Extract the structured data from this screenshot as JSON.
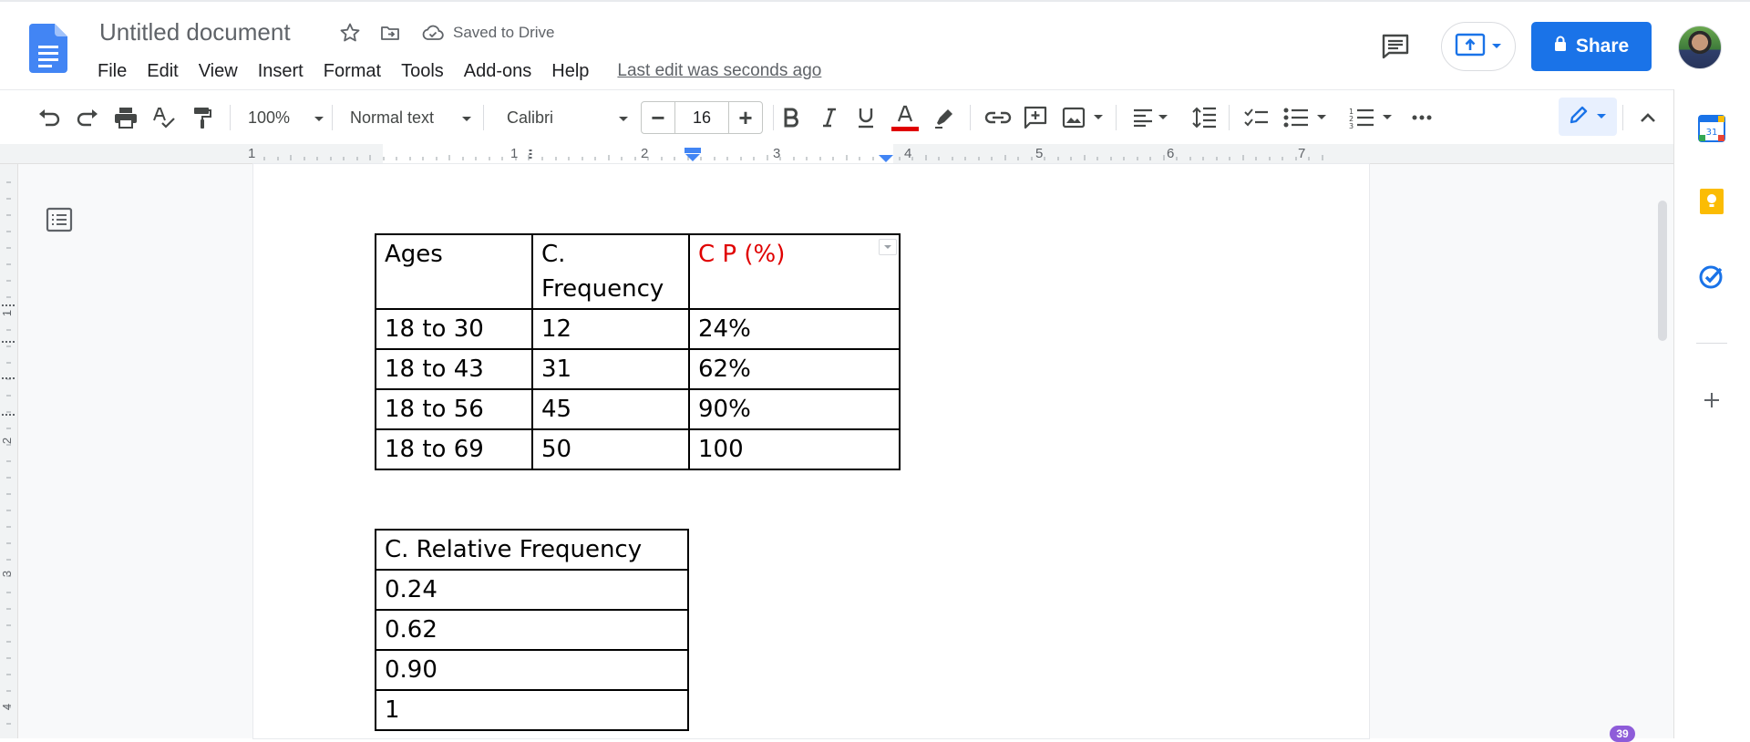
{
  "header": {
    "doc_title": "Untitled document",
    "saved_status": "Saved to Drive",
    "menu": [
      "File",
      "Edit",
      "View",
      "Insert",
      "Format",
      "Tools",
      "Add-ons",
      "Help"
    ],
    "last_edit": "Last edit was seconds ago",
    "share_label": "Share",
    "accent_color": "#1a73e8"
  },
  "toolbar": {
    "zoom": "100%",
    "style": "Normal text",
    "font": "Calibri",
    "font_size": "16",
    "minus": "−",
    "plus": "+",
    "icons": [
      "undo-icon",
      "redo-icon",
      "print-icon",
      "spellcheck-icon",
      "paint-format-icon",
      "bold-icon",
      "italic-icon",
      "underline-icon",
      "text-color-icon",
      "highlight-icon",
      "link-icon",
      "comment-add-icon",
      "image-icon",
      "align-icon",
      "line-spacing-icon",
      "checklist-icon",
      "bullet-list-icon",
      "numbered-list-icon",
      "more-icon",
      "edit-mode-icon",
      "collapse-icon"
    ]
  },
  "ruler": {
    "labels": [
      "1",
      "1",
      "2",
      "3",
      "4",
      "5",
      "6",
      "7"
    ]
  },
  "vertical_ruler": {
    "labels": [
      "1",
      "2",
      "3",
      "4"
    ]
  },
  "table1": {
    "header": [
      "Ages",
      "C. Frequency",
      "C P (%)"
    ],
    "header_lines": {
      "c_freq_line1": "C.",
      "c_freq_line2": "Frequency"
    },
    "rows": [
      [
        "18 to 30",
        "12",
        "24%"
      ],
      [
        "18 to 43",
        "31",
        "62%"
      ],
      [
        "18 to 56",
        "45",
        "90%"
      ],
      [
        "18 to 69",
        "50",
        "100"
      ]
    ],
    "cp_color": "#e00000"
  },
  "table2": {
    "header": "C. Relative Frequency",
    "rows": [
      "0.24",
      "0.62",
      "0.90",
      "1"
    ]
  },
  "side_panel": {
    "calendar_day": "31",
    "icons": [
      "calendar-icon",
      "keep-icon",
      "tasks-icon",
      "add-icon"
    ]
  },
  "notification_badge": "39"
}
